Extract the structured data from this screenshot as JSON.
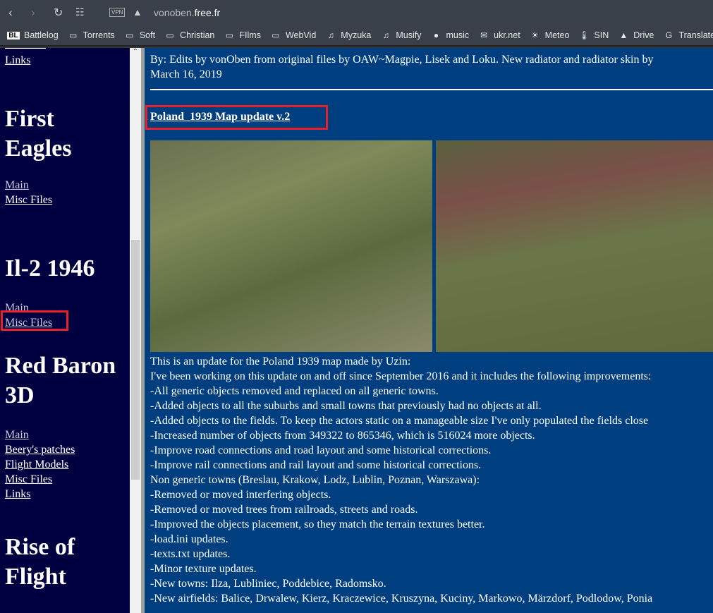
{
  "browser": {
    "url_host": "vonoben.",
    "url_domain": "free.fr",
    "vpn": "VPN"
  },
  "bookmarks": [
    {
      "label": "Battlelog",
      "icon": "BL"
    },
    {
      "label": "Torrents",
      "icon": "folder"
    },
    {
      "label": "Soft",
      "icon": "folder"
    },
    {
      "label": "Christian",
      "icon": "folder"
    },
    {
      "label": "FIlms",
      "icon": "folder"
    },
    {
      "label": "WebVid",
      "icon": "folder"
    },
    {
      "label": "Myzuka",
      "icon": "music"
    },
    {
      "label": "Musify",
      "icon": "music-note"
    },
    {
      "label": "music",
      "icon": "music-circle"
    },
    {
      "label": "ukr.net",
      "icon": "mail"
    },
    {
      "label": "Meteo",
      "icon": "sun"
    },
    {
      "label": "SIN",
      "icon": "thermometer"
    },
    {
      "label": "Drive",
      "icon": "drive"
    },
    {
      "label": "Translate",
      "icon": "google"
    }
  ],
  "sidebar": {
    "top_link": "Links",
    "sections": [
      {
        "title_1": "First",
        "title_2": "Eagles",
        "links": [
          "Main",
          "Misc Files"
        ]
      },
      {
        "title_1": "Il-2 1946",
        "links": [
          "Main",
          "Misc Files"
        ]
      },
      {
        "title_1": "Red Baron",
        "title_2": "3D",
        "links": [
          "Main",
          "Beery's patches",
          "Flight Models",
          "Misc Files",
          "Links"
        ]
      },
      {
        "title_1": "Rise of",
        "title_2": "Flight"
      }
    ]
  },
  "main": {
    "byline": "By: Edits by vonOben from original files by OAW~Magpie, Lisek and Loku. New radiator and radiator skin by",
    "date": "March 16, 2019",
    "title": "Poland_1939 Map update v.2",
    "lines": [
      "This is an update for the Poland 1939 map made by Uzin:",
      "I've been working on this update on and off since September 2016 and it includes the following improvements:",
      "-All generic objects removed and replaced on all generic towns.",
      "-Added objects to all the suburbs and small towns that previously had no objects at all.",
      "-Added objects to the fields. To keep the actors static on a manageable size I've only populated the fields close",
      "-Increased number of objects from 349322 to 865346, which is 516024 more objects.",
      "-Improve road connections and road layout and some historical corrections.",
      "-Improve rail connections and rail layout and some historical corrections.",
      "Non generic towns (Breslau, Krakow, Lodz, Lublin, Poznan, Warszawa):",
      "-Removed or moved interfering objects.",
      "-Removed or moved trees from railroads, streets and roads.",
      "-Improved the objects placement, so they match the terrain textures better.",
      "-load.ini updates.",
      "-texts.txt updates.",
      "-Minor texture updates.",
      "-New towns: Ilza, Lubliniec, Poddebice, Radomsko.",
      "-New airfields: Balice, Drwalew, Kierz, Kraczewice, Kruszyna, Kuciny, Markowo, Märzdorf, Podlodow, Ponia"
    ]
  }
}
